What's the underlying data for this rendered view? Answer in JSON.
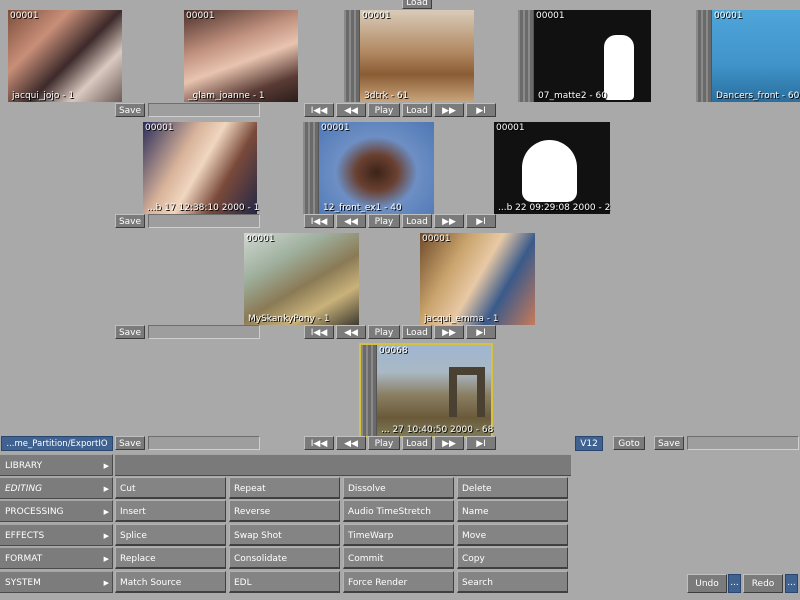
{
  "top_partial_button": "Load",
  "clips": {
    "c1": {
      "timecode": "00001",
      "name": "jacqui_jojo - 1"
    },
    "c2": {
      "timecode": "00001",
      "name": "_glam_joanne - 1"
    },
    "c3": {
      "timecode": "00001",
      "name": "3dtrk - 61"
    },
    "c4": {
      "timecode": "00001",
      "name": "07_matte2 - 60"
    },
    "c5": {
      "timecode": "00001",
      "name": "Dancers_front - 60"
    },
    "c6": {
      "timecode": "00001",
      "name": "...b 17 12:38:10 2000 - 1"
    },
    "c7": {
      "timecode": "00001",
      "name": "12_front_ex1 - 40"
    },
    "c8": {
      "timecode": "00001",
      "name": "...b 22 09:29:08 2000 - 2"
    },
    "c9": {
      "timecode": "00001",
      "name": "MySkankyPony - 1"
    },
    "c10": {
      "timecode": "00001",
      "name": "jacqui_emma - 1"
    },
    "c11": {
      "timecode": "00068",
      "name": "... 27 10:40:50 2000 - 68"
    }
  },
  "controls": {
    "save": "Save",
    "rewind_start": "I◀◀",
    "rewind": "◀◀",
    "play": "Play",
    "load": "Load",
    "forward": "▶▶",
    "forward_end": "▶I"
  },
  "path_button": "...me_Partition/ExportIO",
  "right_controls": {
    "reel": "V12",
    "goto": "Goto",
    "save": "Save"
  },
  "categories": [
    {
      "label": "LIBRARY"
    },
    {
      "label": "EDITING"
    },
    {
      "label": "PROCESSING"
    },
    {
      "label": "EFFECTS"
    },
    {
      "label": "FORMAT"
    },
    {
      "label": "SYSTEM"
    }
  ],
  "commands": {
    "col1": [
      "Cut",
      "Insert",
      "Splice",
      "Replace",
      "Match Source"
    ],
    "col2": [
      "Repeat",
      "Reverse",
      "Swap Shot",
      "Consolidate",
      "EDL"
    ],
    "col3": [
      "Dissolve",
      "Audio TimeStretch",
      "TimeWarp",
      "Commit",
      "Force Render"
    ],
    "col4": [
      "Delete",
      "Name",
      "Move",
      "Copy",
      "Search"
    ]
  },
  "undo": "Undo",
  "redo": "Redo",
  "more": "..."
}
